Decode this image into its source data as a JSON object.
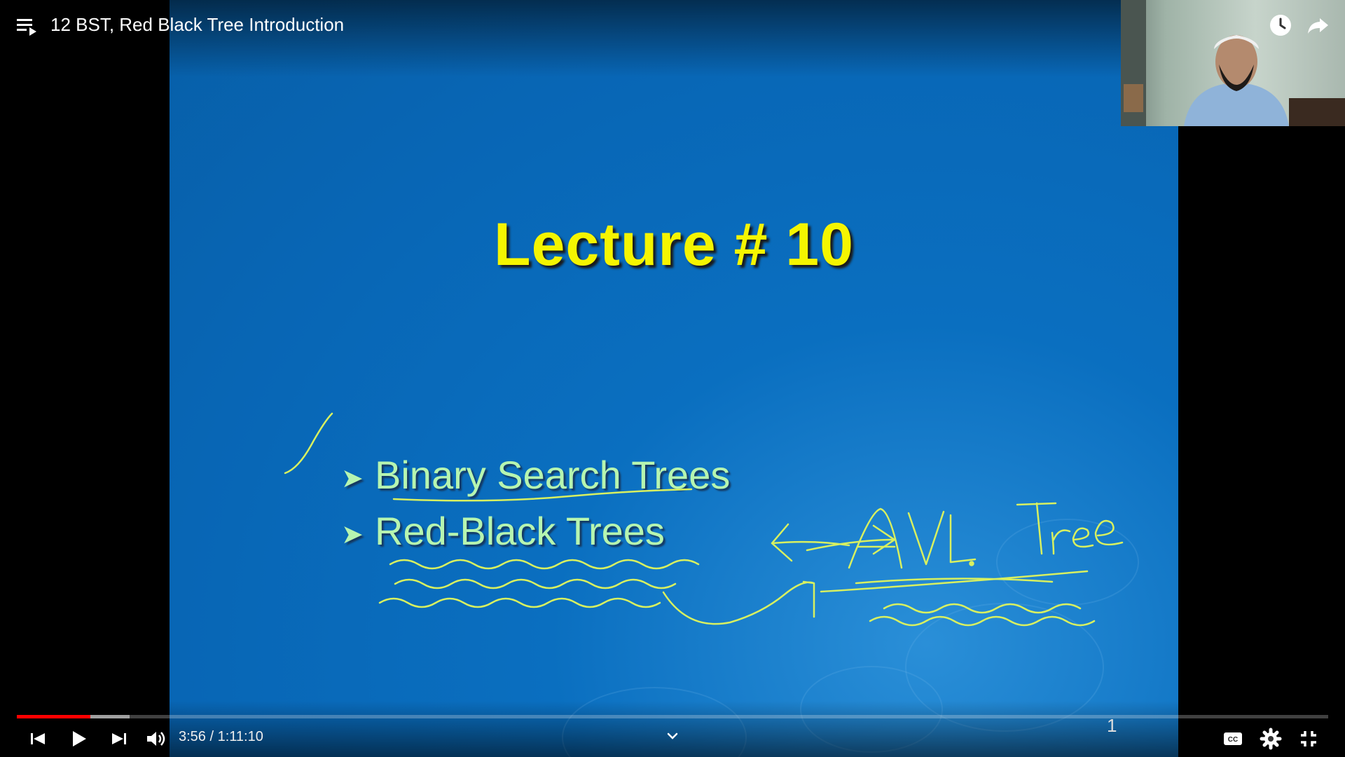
{
  "header": {
    "title": "12 BST, Red Black Tree Introduction"
  },
  "slide": {
    "title": "Lecture # 10",
    "bullets": [
      "Binary Search Trees",
      "Red-Black Trees"
    ],
    "annotation": "AVL Tree",
    "page_number": "1",
    "ink_color": "#d8f060",
    "title_color": "#f5f500",
    "bullet_color": "#b6f5b0",
    "background_color": "#0866b5"
  },
  "controls": {
    "time": "3:56 / 1:11:10",
    "progress_played": 0.056,
    "progress_buffered": 0.086
  },
  "colors": {
    "progress": "#ff0000"
  },
  "icons": [
    "playlist-icon",
    "watch-later-icon",
    "share-icon",
    "previous-icon",
    "play-icon",
    "next-icon",
    "volume-icon",
    "chevron-down-icon",
    "captions-icon",
    "settings-icon",
    "exit-fullscreen-icon"
  ]
}
